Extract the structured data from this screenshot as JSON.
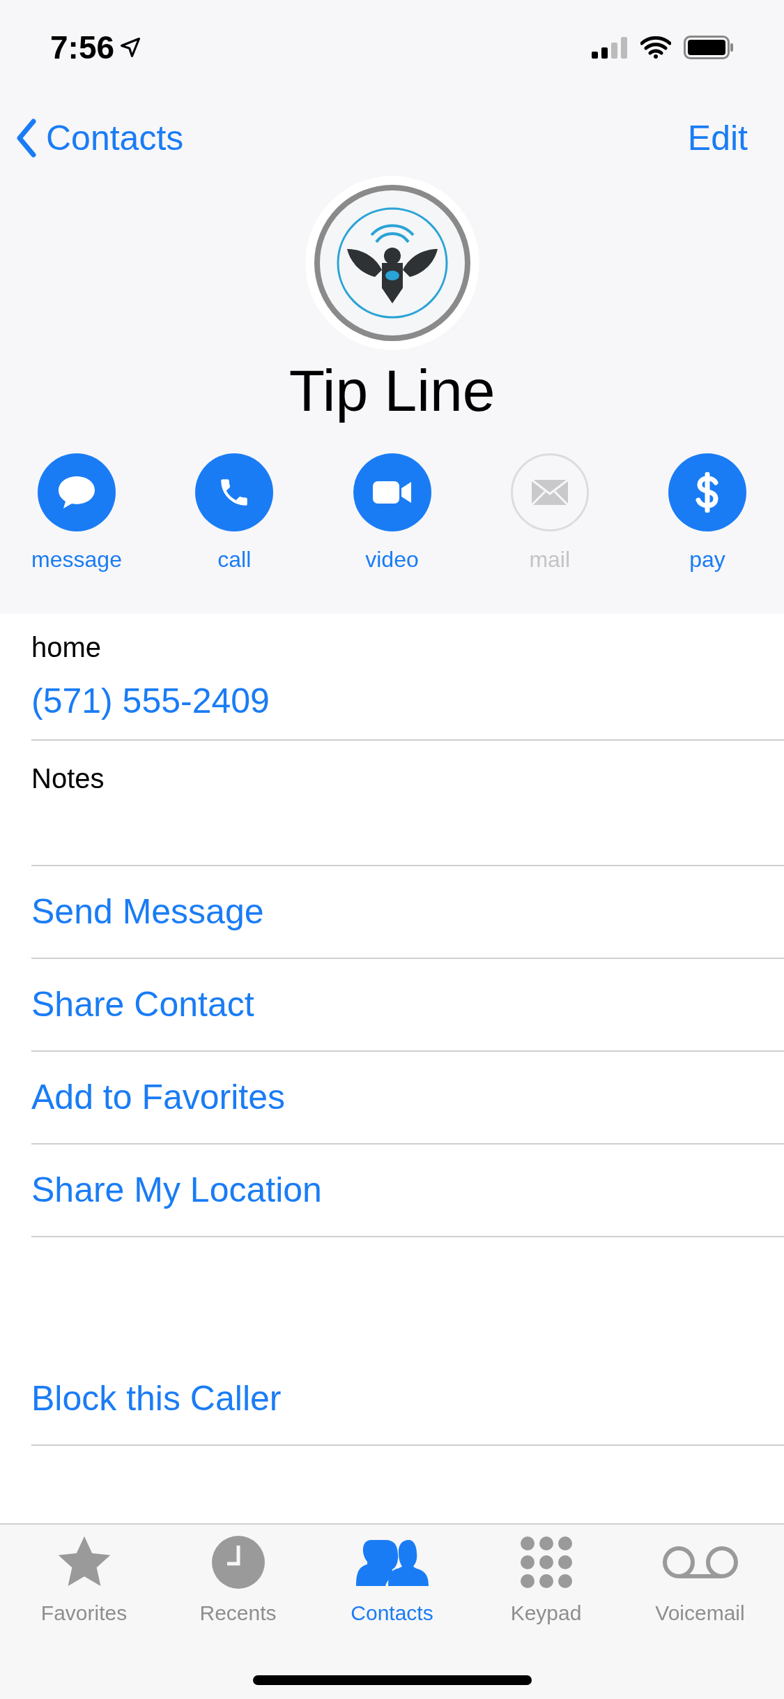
{
  "status_bar": {
    "time": "7:56"
  },
  "nav": {
    "back": "Contacts",
    "action": "Edit"
  },
  "contact": {
    "name": "Tip Line"
  },
  "actions": [
    {
      "kind": "message",
      "label": "message",
      "disabled": false
    },
    {
      "kind": "call",
      "label": "call",
      "disabled": false
    },
    {
      "kind": "video",
      "label": "video",
      "disabled": false
    },
    {
      "kind": "mail",
      "label": "mail",
      "disabled": true
    },
    {
      "kind": "pay",
      "label": "pay",
      "disabled": false
    }
  ],
  "phone": {
    "label": "home",
    "number": "(571) 555-2409"
  },
  "notes": {
    "label": "Notes"
  },
  "links": [
    "Send Message",
    "Share Contact",
    "Add to Favorites",
    "Share My Location"
  ],
  "block": "Block this Caller",
  "tabs": [
    {
      "kind": "favorites",
      "label": "Favorites",
      "selected": false
    },
    {
      "kind": "recents",
      "label": "Recents",
      "selected": false
    },
    {
      "kind": "contacts",
      "label": "Contacts",
      "selected": true
    },
    {
      "kind": "keypad",
      "label": "Keypad",
      "selected": false
    },
    {
      "kind": "voicemail",
      "label": "Voicemail",
      "selected": false
    }
  ]
}
